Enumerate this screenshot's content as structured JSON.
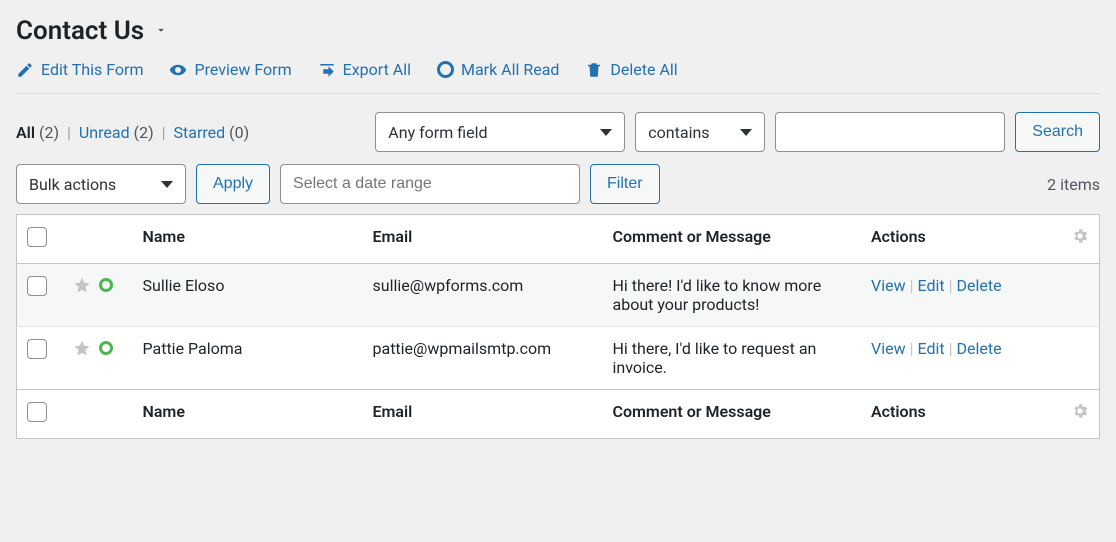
{
  "page": {
    "title": "Contact Us"
  },
  "toolbar": {
    "edit_form_label": "Edit This Form",
    "preview_form_label": "Preview Form",
    "export_all_label": "Export All",
    "mark_all_read_label": "Mark All Read",
    "delete_all_label": "Delete All"
  },
  "status_filters": {
    "all": {
      "label": "All",
      "count": "(2)"
    },
    "unread": {
      "label": "Unread",
      "count": "(2)"
    },
    "starred": {
      "label": "Starred",
      "count": "(0)"
    }
  },
  "search": {
    "field_selected": "Any form field",
    "operator_selected": "contains",
    "value": "",
    "button_label": "Search"
  },
  "bulk": {
    "action_selected": "Bulk actions",
    "apply_label": "Apply",
    "date_placeholder": "Select a date range",
    "filter_label": "Filter"
  },
  "pagination": {
    "items_text": "2 items"
  },
  "columns": {
    "name": "Name",
    "email": "Email",
    "message": "Comment or Message",
    "actions": "Actions"
  },
  "row_actions": {
    "view": "View",
    "edit": "Edit",
    "delete": "Delete"
  },
  "entries": [
    {
      "name": "Sullie Eloso",
      "email": "sullie@wpforms.com",
      "message": "Hi there! I'd like to know more about your products!"
    },
    {
      "name": "Pattie Paloma",
      "email": "pattie@wpmailsmtp.com",
      "message": "Hi there, I'd like to request an invoice."
    }
  ]
}
